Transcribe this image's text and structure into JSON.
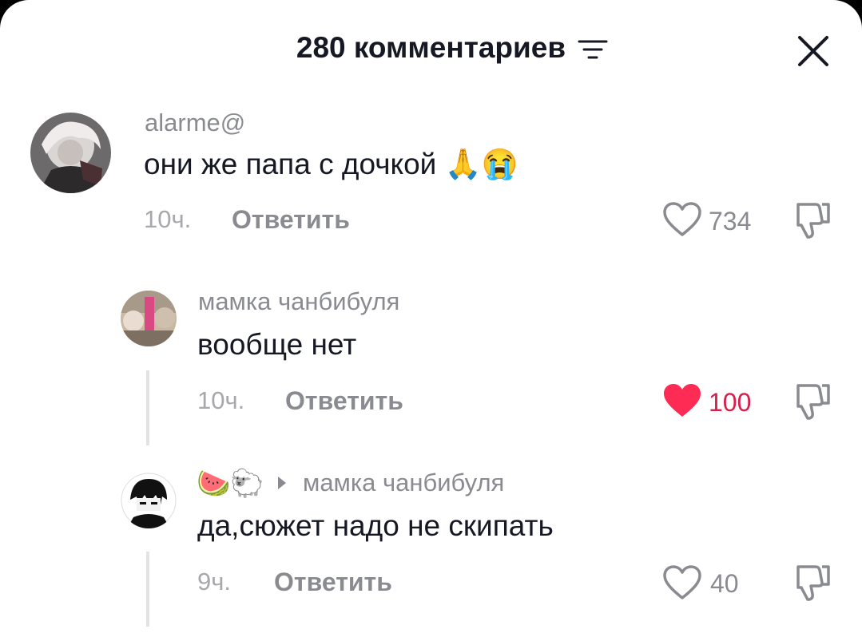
{
  "header": {
    "title": "280 комментариев"
  },
  "colors": {
    "liked": "#fe2c55",
    "text": "#161823",
    "muted": "#8a8b91"
  },
  "comments": [
    {
      "username": "alarme@",
      "text": "они же папа с дочкой",
      "emoji": "🙏😭",
      "time": "10ч.",
      "reply_label": "Ответить",
      "likes": "734",
      "liked": false
    },
    {
      "username": "мамка чанбибуля",
      "text": "вообще нет",
      "time": "10ч.",
      "reply_label": "Ответить",
      "likes": "100",
      "liked": true
    },
    {
      "username_emoji": "🍉🐑",
      "reply_to": "мамка чанбибуля",
      "text": "да,сюжет надо не скипать",
      "time": "9ч.",
      "reply_label": "Ответить",
      "likes": "40",
      "liked": false
    }
  ]
}
